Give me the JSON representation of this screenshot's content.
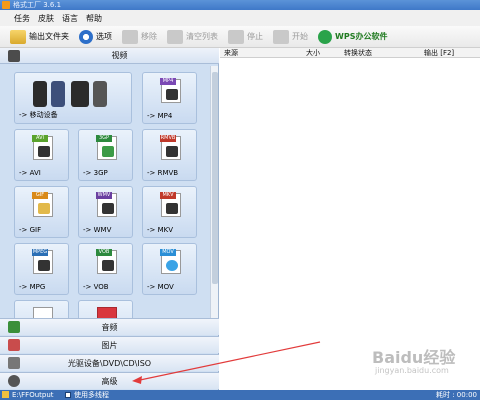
{
  "window": {
    "title": "格式工厂 3.6.1"
  },
  "menu": {
    "items": [
      "任务",
      "皮肤",
      "语言",
      "帮助"
    ]
  },
  "toolbar": {
    "buttons": [
      {
        "label": "输出文件夹",
        "enabled": true
      },
      {
        "label": "选项",
        "enabled": true
      },
      {
        "label": "移除",
        "enabled": false
      },
      {
        "label": "清空列表",
        "enabled": false
      },
      {
        "label": "停止",
        "enabled": false
      },
      {
        "label": "开始",
        "enabled": false
      },
      {
        "label": "WPS办公软件",
        "enabled": true
      }
    ]
  },
  "left": {
    "active_category": "视频",
    "tiles": [
      {
        "label": "-> 移动设备"
      },
      {
        "label": "-> MP4",
        "tag": "MP4"
      },
      {
        "label": "-> AVI",
        "tag": "AVI"
      },
      {
        "label": "-> 3GP",
        "tag": "3GP"
      },
      {
        "label": "-> RMVB",
        "tag": "RMVB"
      },
      {
        "label": "-> GIF",
        "tag": "GIF"
      },
      {
        "label": "-> WMV",
        "tag": "WMV"
      },
      {
        "label": "-> MKV",
        "tag": "MKV"
      },
      {
        "label": "-> MPG",
        "tag": "MPEG"
      },
      {
        "label": "-> VOB",
        "tag": "VOB"
      },
      {
        "label": "-> MOV",
        "tag": "MOV"
      }
    ],
    "categories": [
      "音频",
      "图片",
      "光驱设备\\DVD\\CD\\ISO",
      "高级"
    ]
  },
  "list": {
    "columns": [
      "来源",
      "大小",
      "转换状态",
      "输出 [F2]"
    ]
  },
  "status": {
    "output_path": "E:\\FFOutput",
    "multithread_label": "使用多线程",
    "time_label": "耗时 : 00:00"
  },
  "watermark": {
    "text": "Baidu经验",
    "sub": "jingyan.baidu.com"
  },
  "colors": {
    "accent": "#3c6fb6",
    "panel": "#cfdff2",
    "annotation_arrow": "#e23b3b"
  }
}
